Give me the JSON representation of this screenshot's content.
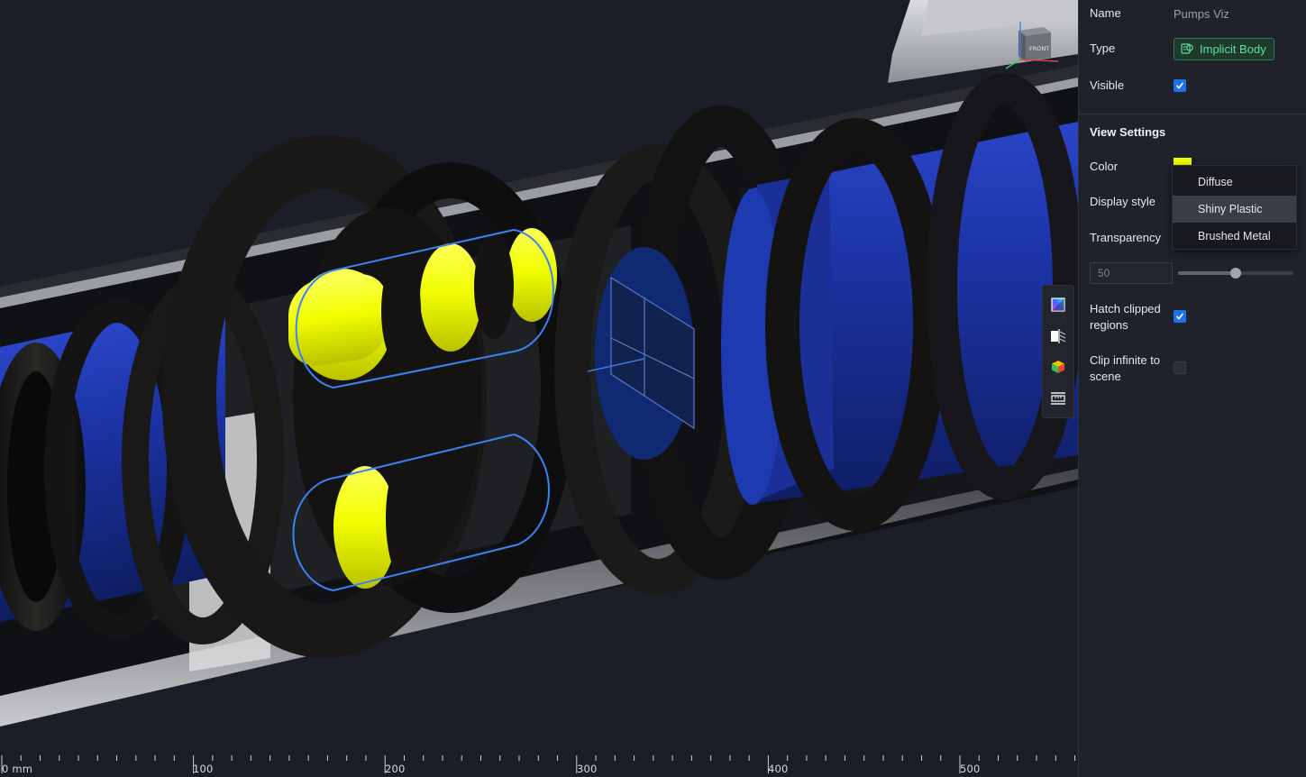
{
  "panel": {
    "name_label": "Name",
    "name_value": "Pumps Viz",
    "type_label": "Type",
    "type_value": "Implicit Body",
    "visible_label": "Visible",
    "visible_checked": true,
    "view_settings_title": "View Settings",
    "color_label": "Color",
    "color_value": "#f3ff00",
    "display_style_label": "Display style",
    "transparency_label": "Transparency",
    "transparency_value": "50",
    "transparency_fraction": 0.5,
    "hatch_label_line1": "Hatch clipped",
    "hatch_label_line2": "regions",
    "hatch_checked": true,
    "clip_label_line1": "Clip infinite to",
    "clip_label_line2": "scene",
    "clip_checked": false
  },
  "dropdown": {
    "options": [
      "Diffuse",
      "Shiny Plastic",
      "Brushed Metal"
    ],
    "selected": "Shiny Plastic"
  },
  "view_cube": {
    "face_label": "FRONT"
  },
  "toolbar": {
    "icons": [
      "color-gradient-icon",
      "section-view-icon",
      "colored-cube-icon",
      "measure-icon"
    ]
  },
  "ruler": {
    "labels": [
      "0 mm",
      "100",
      "200",
      "300",
      "400",
      "500"
    ]
  },
  "colors": {
    "selection_outline": "#3b82f6",
    "part_yellow": "#f3ff00",
    "part_blue": "#1a2f8f",
    "badge_green": "#5fe09b",
    "checkbox_blue": "#1a73e8"
  }
}
